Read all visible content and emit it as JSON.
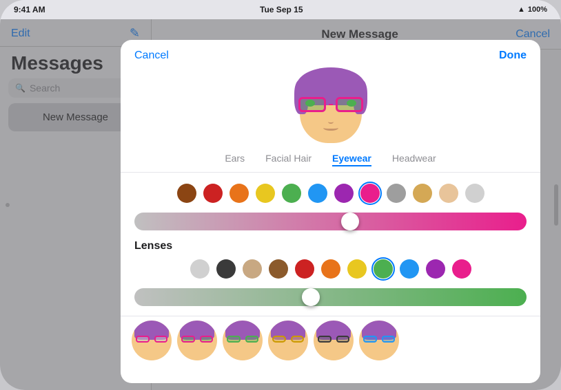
{
  "statusBar": {
    "time": "9:41 AM",
    "date": "Tue Sep 15",
    "wifi": "WiFi",
    "battery": "100%"
  },
  "sidebar": {
    "editLabel": "Edit",
    "title": "Messages",
    "searchPlaceholder": "Search",
    "newMessageLabel": "New Message"
  },
  "mainHeader": {
    "title": "New Message",
    "cancelLabel": "Cancel"
  },
  "modal": {
    "cancelLabel": "Cancel",
    "doneLabel": "Done",
    "avatarEmoji": "🧑‍🦱",
    "tabs": [
      {
        "label": "Ears",
        "active": false
      },
      {
        "label": "Facial Hair",
        "active": false
      },
      {
        "label": "Eyewear",
        "active": true
      },
      {
        "label": "Headwear",
        "active": false
      }
    ],
    "frameColors": [
      {
        "color": "#8B4513",
        "selected": false
      },
      {
        "color": "#cc2222",
        "selected": false
      },
      {
        "color": "#e8731a",
        "selected": false
      },
      {
        "color": "#e8c720",
        "selected": false
      },
      {
        "color": "#4caf50",
        "selected": false
      },
      {
        "color": "#2196f3",
        "selected": false
      },
      {
        "color": "#9c27b0",
        "selected": false
      },
      {
        "color": "#e91e8c",
        "selected": true
      },
      {
        "color": "#9e9e9e",
        "selected": false
      },
      {
        "color": "#d4a855",
        "selected": false
      },
      {
        "color": "#e8c49a",
        "selected": false
      },
      {
        "color": "#d0d0d0",
        "selected": false
      }
    ],
    "frameSlider": {
      "color": "#e91e8c",
      "thumbPosition": 55
    },
    "lensesLabel": "Lenses",
    "lensColors": [
      {
        "color": "#d0d0d0",
        "selected": false
      },
      {
        "color": "#3a3a3a",
        "selected": false
      },
      {
        "color": "#c8a882",
        "selected": false
      },
      {
        "color": "#8B5a2b",
        "selected": false
      },
      {
        "color": "#cc2222",
        "selected": false
      },
      {
        "color": "#e8731a",
        "selected": false
      },
      {
        "color": "#e8c720",
        "selected": false
      },
      {
        "color": "#4caf50",
        "selected": true
      },
      {
        "color": "#2196f3",
        "selected": false
      },
      {
        "color": "#9c27b0",
        "selected": false
      },
      {
        "color": "#e91e8c",
        "selected": false
      }
    ],
    "lensSlider": {
      "color": "#4caf50",
      "thumbPosition": 45
    },
    "emojiPreviews": [
      "🧑‍🦱",
      "🧑‍🦱",
      "🧑‍🦱",
      "🧑‍🦱",
      "🧑‍🦱",
      "🧑‍🦱"
    ]
  }
}
